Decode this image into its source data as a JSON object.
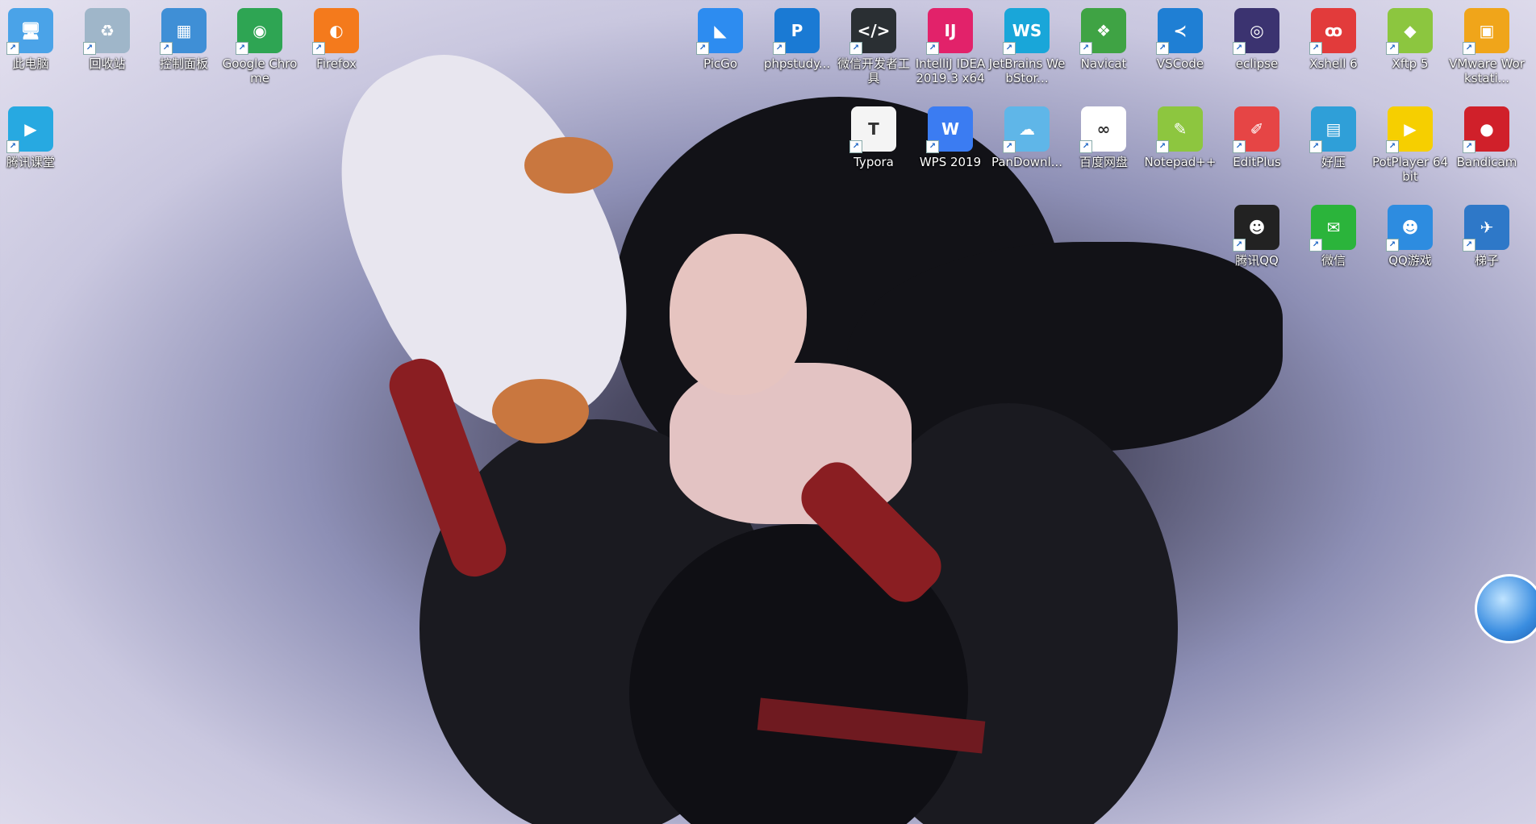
{
  "desktop": {
    "icons": [
      {
        "label": "此电脑",
        "glyph": "🖥",
        "color": "#4aa3e8"
      },
      {
        "label": "回收站",
        "glyph": "♻",
        "color": "#9fb6c9"
      },
      {
        "label": "控制面板",
        "glyph": "▦",
        "color": "#3f8fd6"
      },
      {
        "label": "Google Chrome",
        "glyph": "◉",
        "color": "#2ea553"
      },
      {
        "label": "Firefox",
        "glyph": "◐",
        "color": "#f47a1c"
      },
      {
        "label": "腾讯课堂",
        "glyph": "▶",
        "color": "#27a9e1"
      },
      {
        "label": "PicGo",
        "glyph": "◣",
        "color": "#2d8cf0"
      },
      {
        "label": "phpstudy...",
        "glyph": "P",
        "color": "#1a7ad4"
      },
      {
        "label": "微信开发者工具",
        "glyph": "</>",
        "color": "#2a2f33"
      },
      {
        "label": "IntelliJ IDEA 2019.3 x64",
        "glyph": "IJ",
        "color": "#e2226a"
      },
      {
        "label": "JetBrains WebStor...",
        "glyph": "WS",
        "color": "#19a6d9"
      },
      {
        "label": "Navicat",
        "glyph": "❖",
        "color": "#3fa344"
      },
      {
        "label": "VSCode",
        "glyph": "≺",
        "color": "#1f7fd4"
      },
      {
        "label": "eclipse",
        "glyph": "◎",
        "color": "#3b3370"
      },
      {
        "label": "Xshell 6",
        "glyph": "ꝏ",
        "color": "#e23b3b"
      },
      {
        "label": "Xftp 5",
        "glyph": "◆",
        "color": "#8cc63f"
      },
      {
        "label": "VMware Workstati...",
        "glyph": "▣",
        "color": "#f0a51a"
      },
      {
        "label": "Typora",
        "glyph": "T",
        "color": "#f4f4f4"
      },
      {
        "label": "WPS 2019",
        "glyph": "W",
        "color": "#3b7cf2"
      },
      {
        "label": "PanDownl...",
        "glyph": "☁",
        "color": "#5fb6e8"
      },
      {
        "label": "百度网盘",
        "glyph": "∞",
        "color": "#ffffff"
      },
      {
        "label": "Notepad++",
        "glyph": "✎",
        "color": "#8dc63f"
      },
      {
        "label": "EditPlus",
        "glyph": "✐",
        "color": "#e64545"
      },
      {
        "label": "好压",
        "glyph": "▤",
        "color": "#2f9fd8"
      },
      {
        "label": "PotPlayer 64 bit",
        "glyph": "▶",
        "color": "#f6cf00"
      },
      {
        "label": "Bandicam",
        "glyph": "●",
        "color": "#d0202a"
      },
      {
        "label": "腾讯QQ",
        "glyph": "☻",
        "color": "#222222"
      },
      {
        "label": "微信",
        "glyph": "✉",
        "color": "#2bb43b"
      },
      {
        "label": "QQ游戏",
        "glyph": "☻",
        "color": "#2d8ce0"
      },
      {
        "label": "梯子",
        "glyph": "✈",
        "color": "#2e78c8"
      }
    ]
  }
}
